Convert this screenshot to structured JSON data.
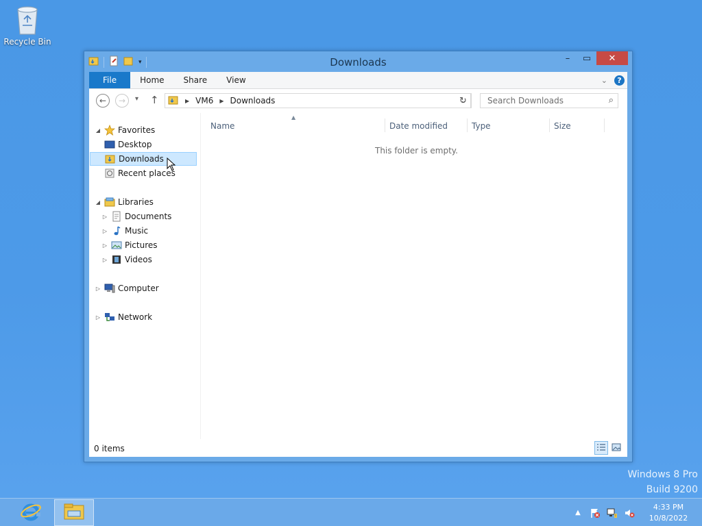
{
  "desktop": {
    "recycle_bin_label": "Recycle Bin"
  },
  "window": {
    "title": "Downloads",
    "close_glyph": "✕",
    "minimize_glyph": "–",
    "maximize_glyph": "▭"
  },
  "ribbon": {
    "tabs": [
      {
        "label": "File"
      },
      {
        "label": "Home"
      },
      {
        "label": "Share"
      },
      {
        "label": "View"
      }
    ],
    "help_glyph": "?"
  },
  "address": {
    "crumbs": [
      "VM6",
      "Downloads"
    ],
    "search_placeholder": "Search Downloads"
  },
  "nav": {
    "favorites": {
      "label": "Favorites",
      "items": [
        "Desktop",
        "Downloads",
        "Recent places"
      ]
    },
    "libraries": {
      "label": "Libraries",
      "items": [
        "Documents",
        "Music",
        "Pictures",
        "Videos"
      ]
    },
    "computer": "Computer",
    "network": "Network",
    "selected": "Downloads"
  },
  "content": {
    "columns": [
      "Name",
      "Date modified",
      "Type",
      "Size"
    ],
    "empty_message": "This folder is empty."
  },
  "status": {
    "item_count": "0 items"
  },
  "watermark": {
    "line1": "Windows 8 Pro",
    "line2": "Build 9200"
  },
  "taskbar": {
    "time": "4:33 PM",
    "date": "10/8/2022"
  },
  "colors": {
    "accent": "#1979ca",
    "close": "#c74a45",
    "selection": "#cde8ff",
    "desktop": "#4d9ae8"
  }
}
